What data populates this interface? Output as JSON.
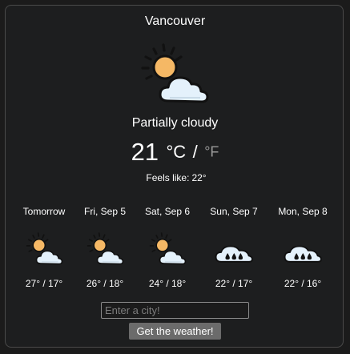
{
  "city": "Vancouver",
  "current": {
    "icon": "partly-cloudy-icon",
    "description": "Partially cloudy",
    "temperature": "21",
    "unit_active": "°C",
    "unit_separator": "/",
    "unit_inactive": "°F",
    "feels_like_label": "Feels like:",
    "feels_like_value": "22°"
  },
  "forecast": [
    {
      "day": "Tomorrow",
      "icon": "partly-cloudy-icon",
      "temps": "27° / 17°"
    },
    {
      "day": "Fri, Sep 5",
      "icon": "partly-cloudy-icon",
      "temps": "26° / 18°"
    },
    {
      "day": "Sat, Sep 6",
      "icon": "partly-cloudy-icon",
      "temps": "24° / 18°"
    },
    {
      "day": "Sun, Sep 7",
      "icon": "rain-cloud-icon",
      "temps": "22° / 17°"
    },
    {
      "day": "Mon, Sep 8",
      "icon": "rain-cloud-icon",
      "temps": "22° / 16°"
    }
  ],
  "search": {
    "placeholder": "Enter a city!",
    "button_label": "Get the weather!"
  },
  "colors": {
    "background": "#1b1b1b",
    "sun": "#f5b865",
    "cloud_fill": "#e4f1fb",
    "outline": "#111111"
  }
}
